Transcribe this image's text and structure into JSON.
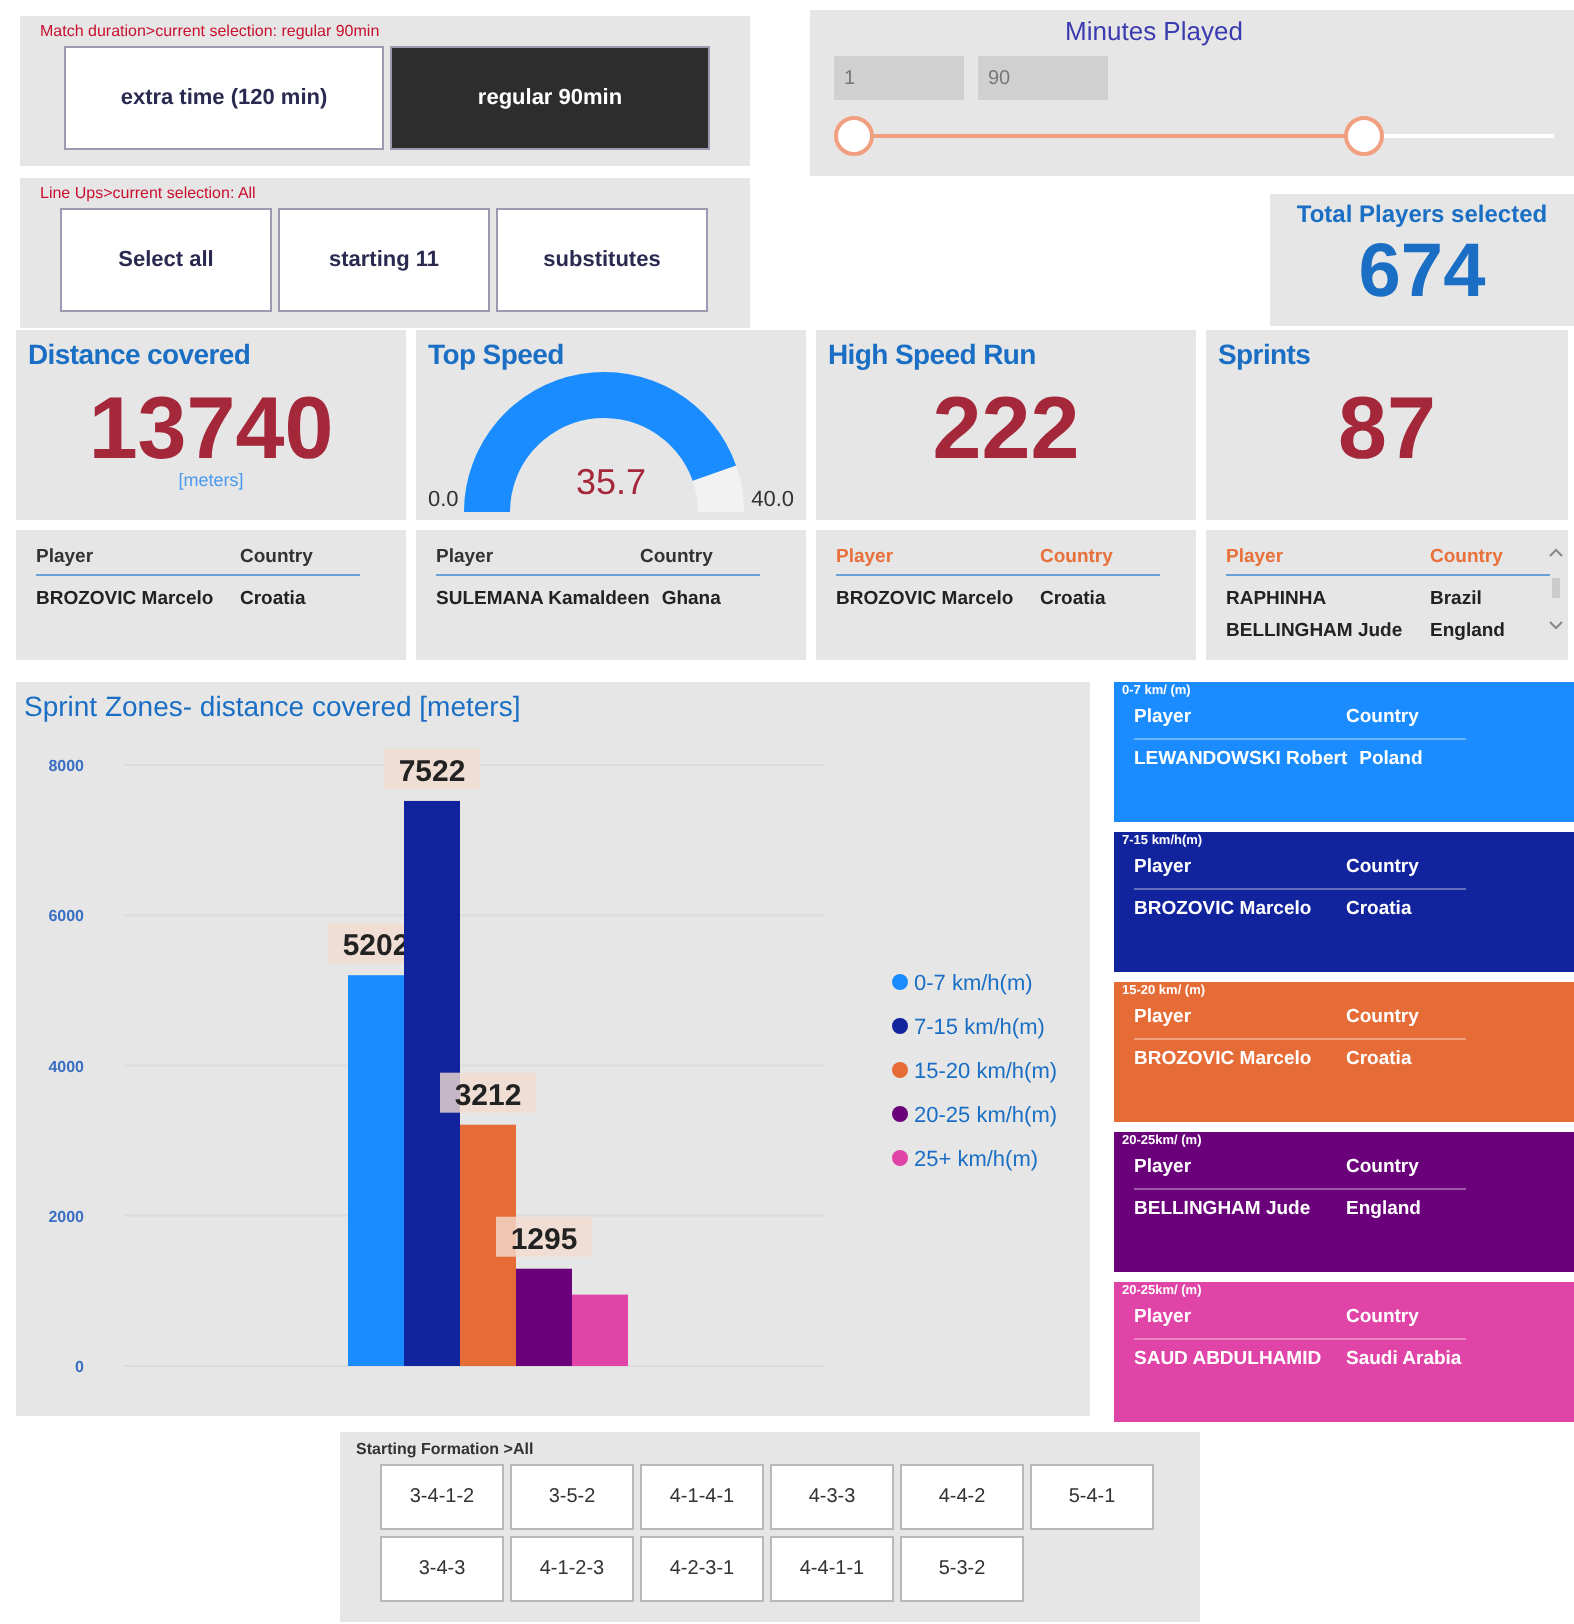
{
  "match_duration": {
    "label": "Match duration>current selection: regular 90min",
    "options": [
      {
        "label": "extra time (120 min)",
        "selected": false
      },
      {
        "label": "regular 90min",
        "selected": true
      }
    ]
  },
  "line_ups": {
    "label": "Line Ups>current selection: All",
    "options": [
      {
        "label": "Select all",
        "selected": false
      },
      {
        "label": "starting 11",
        "selected": false
      },
      {
        "label": "substitutes",
        "selected": false
      }
    ]
  },
  "minutes_played": {
    "title": "Minutes Played",
    "min_value": "1",
    "max_value": "90",
    "thumbs": [
      {
        "level": 0
      },
      {
        "level": 0.75
      }
    ]
  },
  "total_players": {
    "title": "Total Players selected",
    "value": "674"
  },
  "kpis": [
    {
      "kind": "number",
      "title": "Distance covered",
      "value": "13740",
      "unit": "[meters]",
      "table": {
        "color": "#333333",
        "columns": [
          "Player",
          "Country"
        ],
        "rows": [
          [
            "BROZOVIC Marcelo",
            "Croatia"
          ]
        ]
      }
    },
    {
      "kind": "gauge",
      "title": "Top Speed",
      "value": "35.7",
      "min": "0.0",
      "max": "40.0",
      "table": {
        "color": "#333333",
        "columns": [
          "Player",
          "Country"
        ],
        "rows": [
          [
            "SULEMANA Kamaldeen",
            "Ghana"
          ]
        ]
      }
    },
    {
      "kind": "number",
      "title": "High Speed Run",
      "value": "222",
      "table": {
        "color": "#e8703a",
        "columns": [
          "Player",
          "Country"
        ],
        "rows": [
          [
            "BROZOVIC Marcelo",
            "Croatia"
          ]
        ]
      }
    },
    {
      "kind": "number",
      "title": "Sprints",
      "value": "87",
      "table": {
        "color": "#e8703a",
        "columns": [
          "Player",
          "Country"
        ],
        "rows": [
          [
            "RAPHINHA",
            "Brazil"
          ],
          [
            "BELLINGHAM Jude",
            "England"
          ]
        ]
      }
    }
  ],
  "sprint_chart": {
    "chart_data": {
      "type": "bar",
      "title": "Sprint Zones- distance covered [meters]",
      "categories": [
        null
      ],
      "grid": true,
      "legend": "right",
      "series": [
        {
          "name": "0-7 km/h(m)",
          "color": "#1a8cff",
          "values": [
            5202
          ]
        },
        {
          "name": "7-15 km/h(m)",
          "color": "#12239e",
          "values": [
            7522
          ]
        },
        {
          "name": "15-20 km/h(m)",
          "color": "#e66c37",
          "values": [
            3212
          ]
        },
        {
          "name": "20-25 km/h(m)",
          "color": "#6b007b",
          "values": [
            1295
          ]
        },
        {
          "name": "25+ km/h(m)",
          "color": "#e044a7",
          "values": [
            950
          ]
        }
      ],
      "ylim": [
        0,
        8200
      ],
      "yticks": [
        0,
        2000,
        4000,
        6000,
        8000
      ],
      "value_labels": [
        "5202",
        "7522",
        "3212",
        "1295",
        null
      ]
    }
  },
  "zone_tables": [
    {
      "title": "0-7 km/ (m)",
      "color": "#1a8cff",
      "columns": [
        "Player",
        "Country"
      ],
      "rows": [
        [
          "LEWANDOWSKI Robert",
          "Poland"
        ]
      ]
    },
    {
      "title": "7-15 km/h(m)",
      "color": "#12239e",
      "columns": [
        "Player",
        "Country"
      ],
      "rows": [
        [
          "BROZOVIC Marcelo",
          "Croatia"
        ]
      ]
    },
    {
      "title": "15-20 km/ (m)",
      "color": "#e66c37",
      "columns": [
        "Player",
        "Country"
      ],
      "rows": [
        [
          "BROZOVIC Marcelo",
          "Croatia"
        ]
      ]
    },
    {
      "title": "20-25km/ (m)",
      "color": "#6b007b",
      "columns": [
        "Player",
        "Country"
      ],
      "rows": [
        [
          "BELLINGHAM Jude",
          "England"
        ]
      ]
    },
    {
      "title": "20-25km/ (m)",
      "color": "#e044a7",
      "columns": [
        "Player",
        "Country"
      ],
      "rows": [
        [
          "SAUD ABDULHAMID",
          "Saudi Arabia"
        ]
      ]
    }
  ],
  "formation": {
    "label": "Starting Formation >All",
    "options": [
      {
        "label": "3-4-1-2",
        "selected": false
      },
      {
        "label": "3-5-2",
        "selected": false
      },
      {
        "label": "4-1-4-1",
        "selected": false
      },
      {
        "label": "4-3-3",
        "selected": false
      },
      {
        "label": "4-4-2",
        "selected": false
      },
      {
        "label": "5-4-1",
        "selected": false
      },
      {
        "label": "3-4-3",
        "selected": false
      },
      {
        "label": "4-1-2-3",
        "selected": false
      },
      {
        "label": "4-2-3-1",
        "selected": false
      },
      {
        "label": "4-4-1-1",
        "selected": false
      },
      {
        "label": "5-3-2",
        "selected": false
      }
    ]
  }
}
